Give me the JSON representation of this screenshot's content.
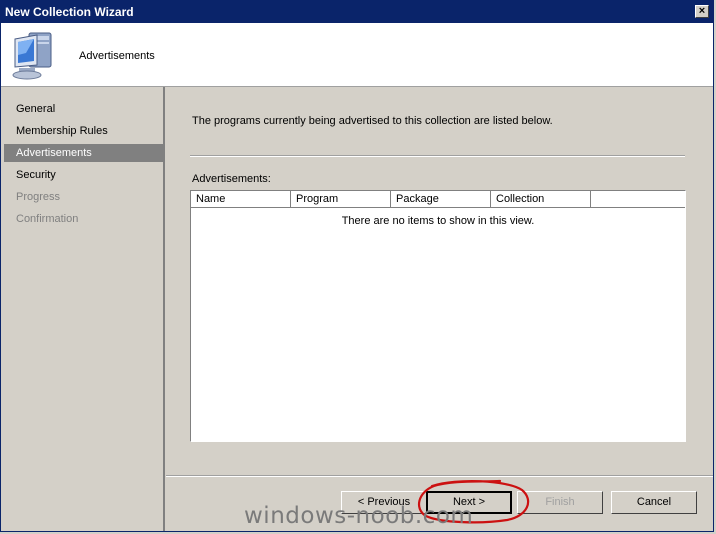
{
  "window": {
    "title": "New Collection Wizard",
    "close_label": "×"
  },
  "header": {
    "title": "Advertisements",
    "icon": "computer-icon"
  },
  "nav": {
    "items": [
      {
        "label": "General",
        "state": "normal"
      },
      {
        "label": "Membership Rules",
        "state": "normal"
      },
      {
        "label": "Advertisements",
        "state": "selected"
      },
      {
        "label": "Security",
        "state": "normal"
      },
      {
        "label": "Progress",
        "state": "disabled"
      },
      {
        "label": "Confirmation",
        "state": "disabled"
      }
    ]
  },
  "main": {
    "description": "The programs currently being advertised to this collection are listed below.",
    "list_label": "Advertisements:",
    "columns": [
      "Name",
      "Program",
      "Package",
      "Collection"
    ],
    "empty_message": "There are no items to show in this view."
  },
  "buttons": {
    "previous": "< Previous",
    "next": "Next >",
    "finish": "Finish",
    "cancel": "Cancel"
  },
  "watermark": "windows-noob.com",
  "colors": {
    "titlebar": "#0a246a",
    "selected_nav": "#808080",
    "annotation": "#cc1111"
  }
}
